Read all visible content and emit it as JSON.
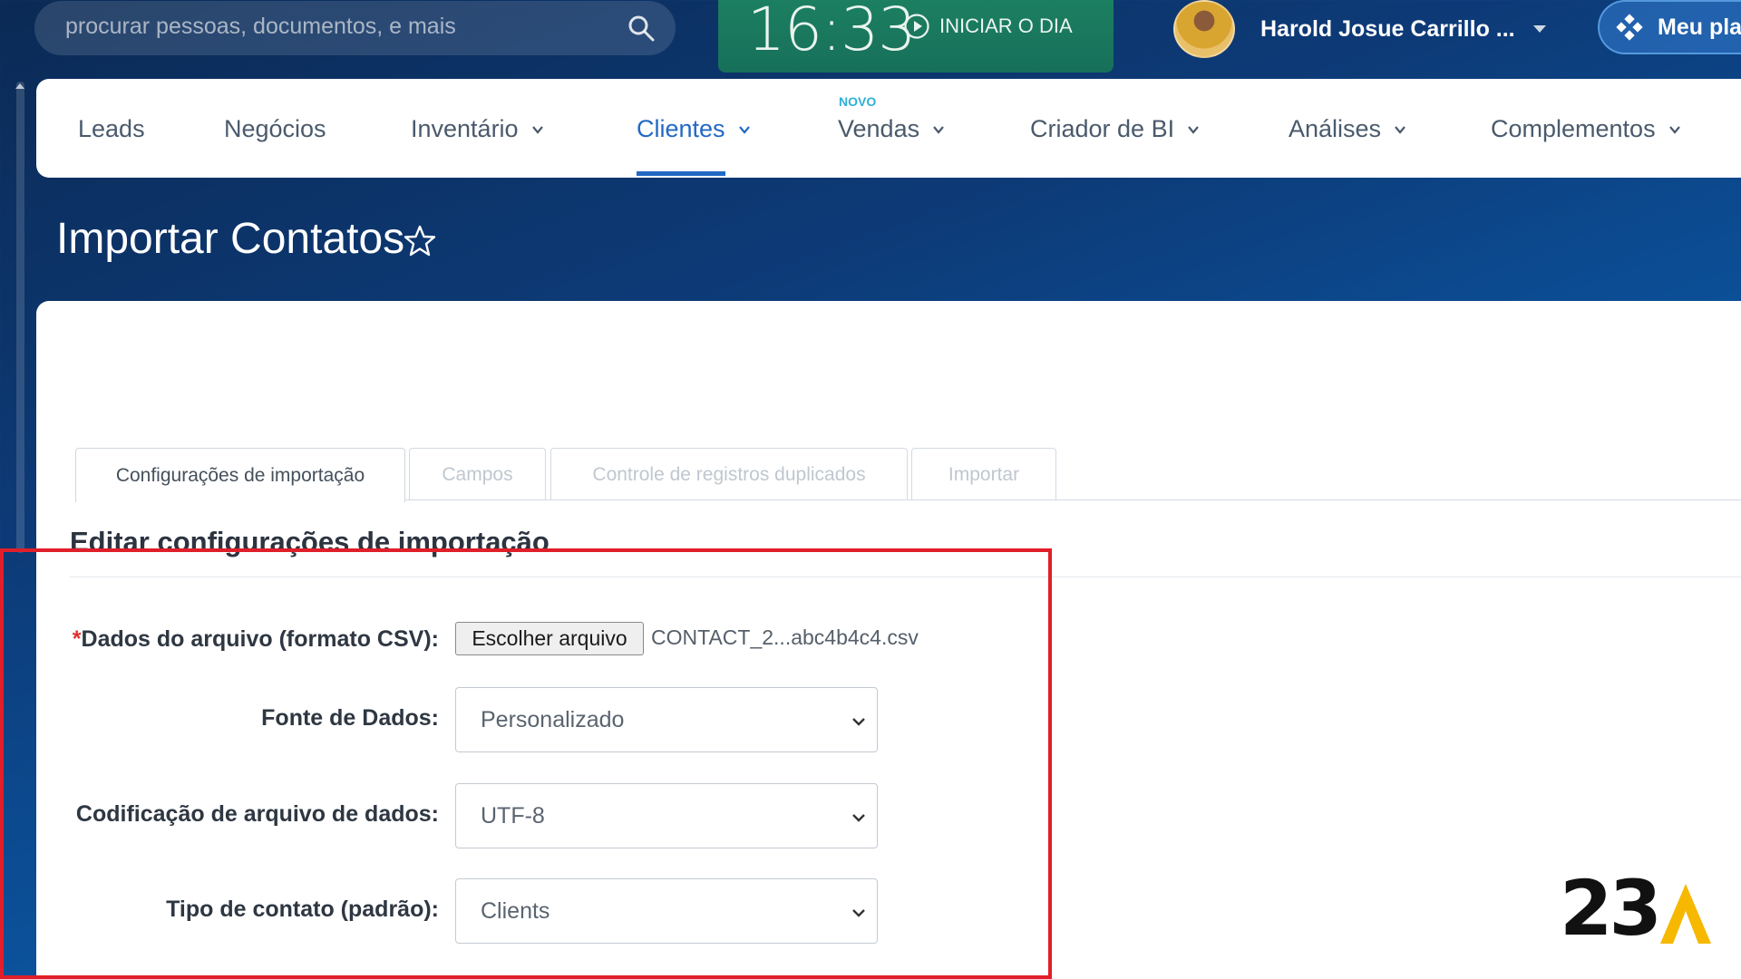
{
  "topbar": {
    "search_placeholder": "procurar pessoas, documentos, e mais",
    "clock": "16:33",
    "start_day_label": "INICIAR O DIA",
    "user_name": "Harold Josue Carrillo ...",
    "plan_label": "Meu pla"
  },
  "nav": {
    "items": [
      {
        "label": "Leads"
      },
      {
        "label": "Negócios"
      },
      {
        "label": "Inventário"
      },
      {
        "label": "Clientes"
      },
      {
        "label": "Vendas",
        "badge": "NOVO"
      },
      {
        "label": "Criador de BI"
      },
      {
        "label": "Análises"
      },
      {
        "label": "Complementos"
      }
    ],
    "active": "Clientes"
  },
  "page": {
    "title": "Importar Contatos"
  },
  "tabs": [
    {
      "label": "Configurações de importação",
      "active": true
    },
    {
      "label": "Campos",
      "active": false
    },
    {
      "label": "Controle de registros duplicados",
      "active": false
    },
    {
      "label": "Importar",
      "active": false
    }
  ],
  "form": {
    "section_title": "Editar configurações de importação",
    "file": {
      "required_mark": "*",
      "label": "Dados do arquivo (formato CSV):",
      "button_label": "Escolher arquivo",
      "file_name": "CONTACT_2...abc4b4c4.csv"
    },
    "data_source": {
      "label": "Fonte de Dados:",
      "value": "Personalizado"
    },
    "encoding": {
      "label": "Codificação de arquivo de dados:",
      "value": "UTF-8"
    },
    "contact_type": {
      "label": "Tipo de contato (padrão):",
      "value": "Clients"
    }
  },
  "watermark": {
    "text": "23"
  },
  "colors": {
    "accent": "#2269c4",
    "highlight": "#e01f2a",
    "clock_bg": "#1c7f60",
    "novo": "#2fb0d6"
  }
}
